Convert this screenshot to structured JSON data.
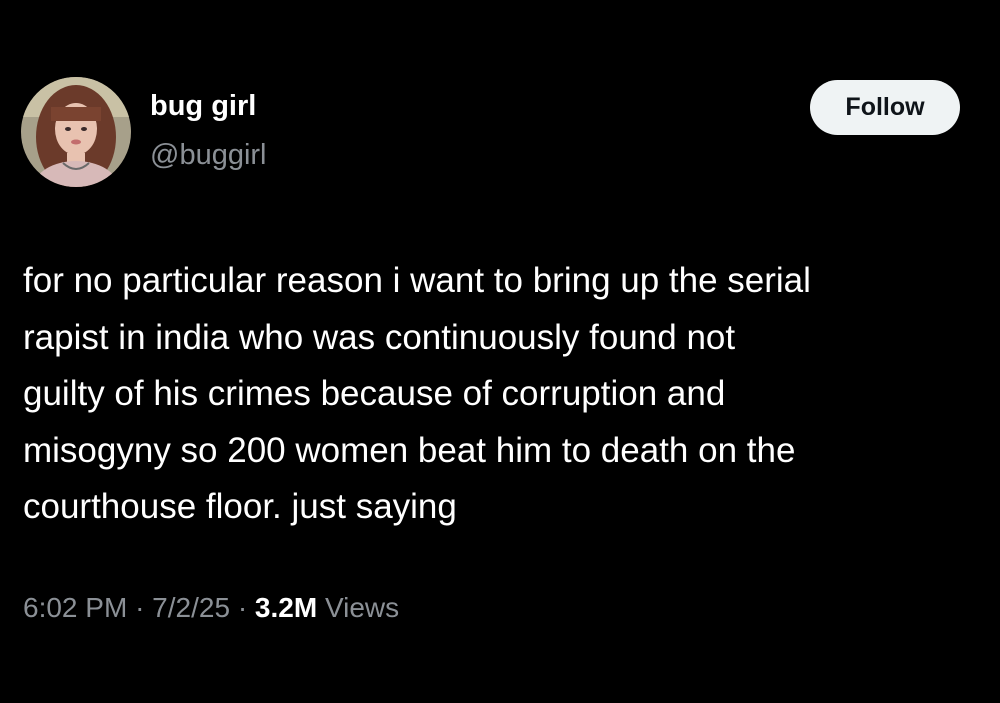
{
  "author": {
    "display_name": "bug girl",
    "handle": "@buggirl",
    "avatar": "profile-photo"
  },
  "follow_button": {
    "label": "Follow"
  },
  "tweet": {
    "lines": [
      "for no particular reason i want to bring up the serial",
      "rapist in india who was continuously found not",
      "guilty of his crimes because of corruption and",
      "misogyny so 200 women beat him to death on the",
      "courthouse floor. just saying"
    ]
  },
  "meta": {
    "time": "6:02 PM",
    "separator": "·",
    "date": "7/2/25",
    "views_count": "3.2M",
    "views_label": "Views"
  },
  "colors": {
    "background": "#000000",
    "text_primary": "#ffffff",
    "text_secondary": "#8b9096",
    "follow_bg": "#eff3f4",
    "follow_text": "#0f1419"
  }
}
